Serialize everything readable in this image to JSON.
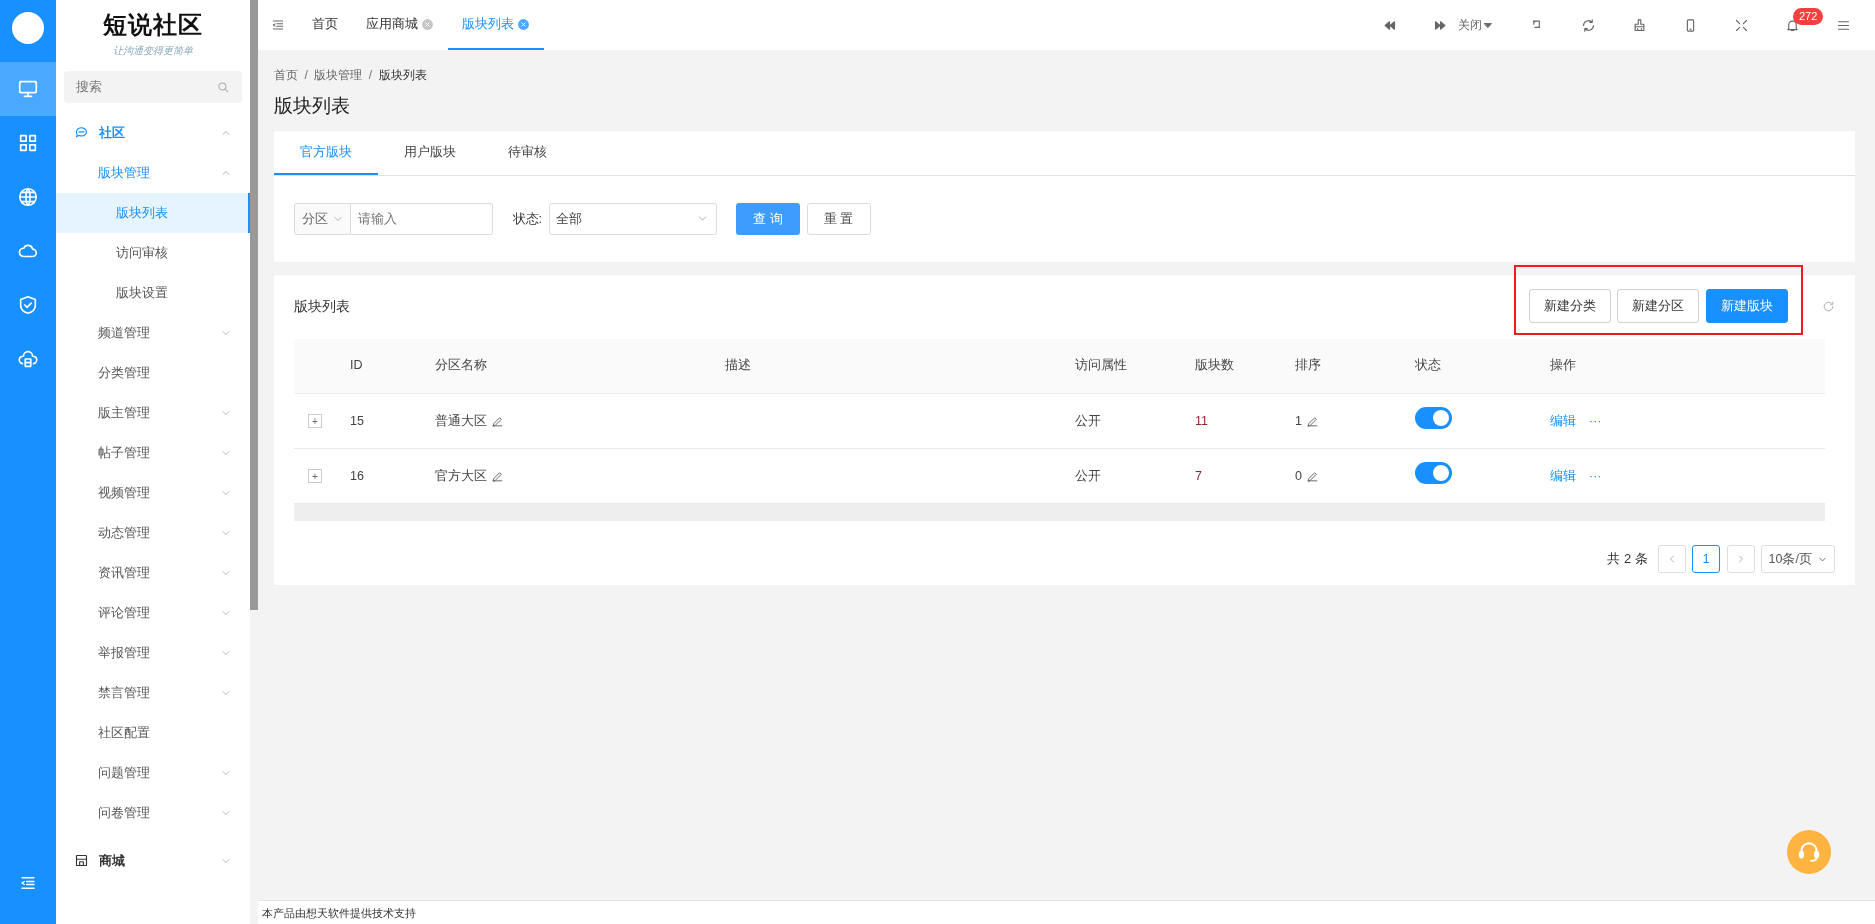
{
  "logo": {
    "title": "短说社区",
    "slogan": "让沟通变得更简单"
  },
  "rail": {
    "items": [
      {
        "selected": true
      },
      {
        "selected": false
      },
      {
        "selected": false
      },
      {
        "selected": false
      },
      {
        "selected": false
      },
      {
        "selected": false
      }
    ]
  },
  "sidebar": {
    "search": {
      "placeholder": "搜索"
    },
    "items": [
      {
        "label": "社区",
        "expanded": true,
        "selected": false,
        "children": [
          {
            "label": "版块管理",
            "expanded": true,
            "selected": false,
            "children": [
              {
                "label": "版块列表",
                "selected": true
              },
              {
                "label": "访问审核",
                "selected": false
              },
              {
                "label": "版块设置",
                "selected": false
              }
            ]
          },
          {
            "label": "频道管理",
            "expanded": false,
            "selected": false
          },
          {
            "label": "分类管理",
            "selected": false
          },
          {
            "label": "版主管理",
            "expanded": false,
            "selected": false
          },
          {
            "label": "帖子管理",
            "expanded": false,
            "selected": false
          },
          {
            "label": "视频管理",
            "expanded": false,
            "selected": false
          },
          {
            "label": "动态管理",
            "expanded": false,
            "selected": false
          },
          {
            "label": "资讯管理",
            "expanded": false,
            "selected": false
          },
          {
            "label": "评论管理",
            "expanded": false,
            "selected": false
          },
          {
            "label": "举报管理",
            "expanded": false,
            "selected": false
          },
          {
            "label": "禁言管理",
            "expanded": false,
            "selected": false
          },
          {
            "label": "社区配置",
            "selected": false
          },
          {
            "label": "问题管理",
            "expanded": false,
            "selected": false
          },
          {
            "label": "问卷管理",
            "expanded": false,
            "selected": false
          }
        ]
      },
      {
        "label": "商城",
        "expanded": false,
        "selected": false
      }
    ]
  },
  "tabs": [
    {
      "label": "首页",
      "closable": false,
      "selected": false
    },
    {
      "label": "应用商城",
      "closable": true,
      "selected": false
    },
    {
      "label": "版块列表",
      "closable": true,
      "selected": true
    }
  ],
  "toolbar": {
    "close_menu": "关闭",
    "notifications": "272"
  },
  "breadcrumb": {
    "separator": "/",
    "items": [
      "首页",
      "版块管理",
      "版块列表"
    ]
  },
  "page_title": "版块列表",
  "section_tabs": [
    {
      "label": "官方版块",
      "selected": true
    },
    {
      "label": "用户版块",
      "selected": false
    },
    {
      "label": "待审核",
      "selected": false
    }
  ],
  "filter": {
    "zone_select": "分区",
    "keyword": {
      "placeholder": "请输入"
    },
    "status_label": "状态:",
    "status_select": "全部",
    "query_button": "查 询",
    "reset_button": "重 置"
  },
  "list": {
    "title": "版块列表",
    "buttons": [
      {
        "label": "新建分类",
        "primary": false
      },
      {
        "label": "新建分区",
        "primary": false
      },
      {
        "label": "新建版块",
        "primary": true
      }
    ],
    "table": {
      "columns": [
        "ID",
        "分区名称",
        "描述",
        "访问属性",
        "版块数",
        "排序",
        "状态",
        "操作"
      ],
      "rows": [
        {
          "expand": "+",
          "id": "15",
          "name": "普通大区",
          "access": "公开",
          "count": "11",
          "sort": "1",
          "enabled": true,
          "edit": "编辑",
          "more": "···"
        },
        {
          "expand": "+",
          "id": "16",
          "name": "官方大区",
          "access": "公开",
          "count": "7",
          "sort": "0",
          "enabled": true,
          "edit": "编辑",
          "more": "···"
        }
      ]
    },
    "pagination": {
      "total": "共 2 条",
      "pages": [
        {
          "label": "1",
          "selected": true
        }
      ],
      "page_size": "10条/页"
    }
  },
  "footer": "本产品由想天软件提供技术支持"
}
